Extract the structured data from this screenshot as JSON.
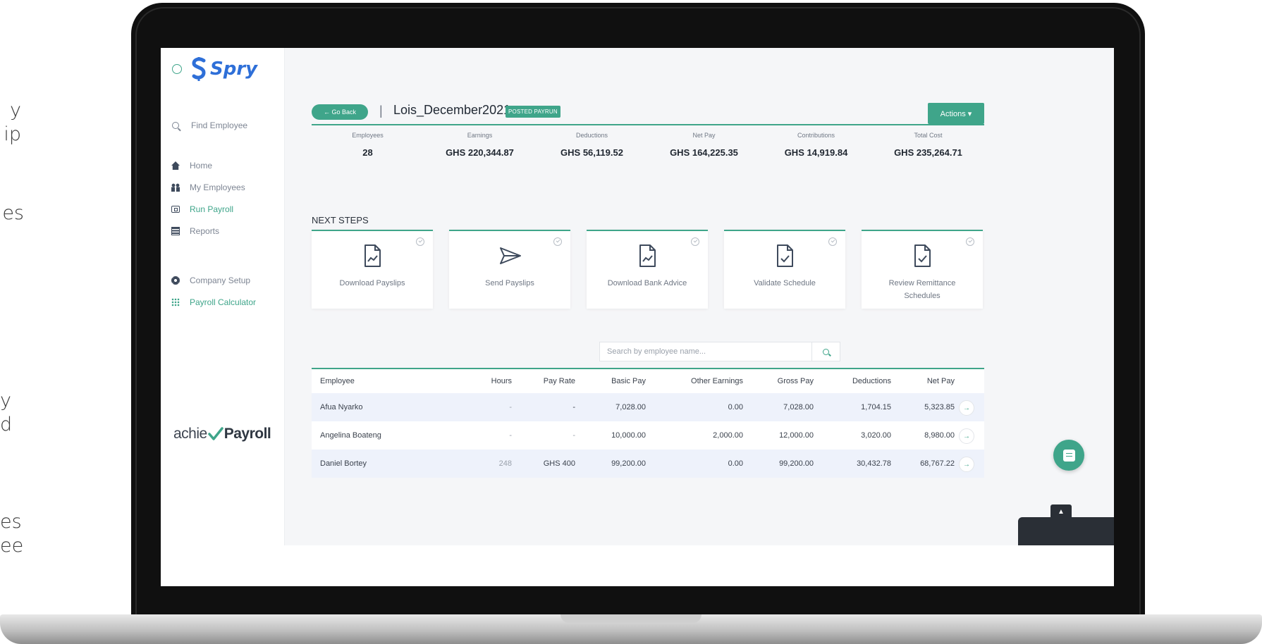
{
  "side_text": {
    "line1": "y",
    "line2": "ip",
    "line3": "es",
    "line4": "y",
    "line5": "d",
    "line6": "es",
    "line7": "ee"
  },
  "app": {
    "brand": "Spry",
    "find_employee": "Find Employee",
    "nav": [
      {
        "label": "Home",
        "icon": "home-icon"
      },
      {
        "label": "My Employees",
        "icon": "people-icon"
      },
      {
        "label": "Run Payroll",
        "icon": "money-icon"
      },
      {
        "label": "Reports",
        "icon": "report-icon"
      },
      {
        "label": "Company Setup",
        "icon": "gear-icon"
      },
      {
        "label": "Payroll Calculator",
        "icon": "grid-icon"
      }
    ],
    "footer_brand_a": "achie",
    "footer_brand_b": "Payroll"
  },
  "header": {
    "back_label": "← Go Back",
    "separator": "|",
    "title": "Lois_December2021",
    "status_badge": "POSTED PAYRUN",
    "actions_label": "Actions ▾"
  },
  "summary": [
    {
      "label": "Employees",
      "value": "28"
    },
    {
      "label": "Earnings",
      "value": "GHS 220,344.87"
    },
    {
      "label": "Deductions",
      "value": "GHS 56,119.52"
    },
    {
      "label": "Net Pay",
      "value": "GHS 164,225.35"
    },
    {
      "label": "Contributions",
      "value": "GHS 14,919.84"
    },
    {
      "label": "Total Cost",
      "value": "GHS 235,264.71"
    }
  ],
  "next_steps": {
    "title": "NEXT STEPS",
    "cards": [
      {
        "label": "Download Payslips",
        "icon": "document-chart-icon"
      },
      {
        "label": "Send Payslips",
        "icon": "send-icon"
      },
      {
        "label": "Download Bank Advice",
        "icon": "document-chart-icon"
      },
      {
        "label": "Validate Schedule",
        "icon": "document-check-icon"
      },
      {
        "label": "Review Remittance Schedules",
        "icon": "document-check-icon"
      }
    ]
  },
  "search": {
    "placeholder": "Search by employee name..."
  },
  "table": {
    "columns": [
      "Employee",
      "Hours",
      "Pay Rate",
      "Basic Pay",
      "Other Earnings",
      "Gross Pay",
      "Deductions",
      "Net Pay"
    ],
    "rows": [
      {
        "employee": "Afua Nyarko",
        "hours": "-",
        "rate": "-",
        "basic": "7,028.00",
        "other": "0.00",
        "gross": "7,028.00",
        "deductions": "1,704.15",
        "net": "5,323.85"
      },
      {
        "employee": "Angelina Boateng",
        "hours": "-",
        "rate": "-",
        "basic": "10,000.00",
        "other": "2,000.00",
        "gross": "12,000.00",
        "deductions": "3,020.00",
        "net": "8,980.00"
      },
      {
        "employee": "Daniel Bortey",
        "hours": "248",
        "rate": "GHS 400",
        "basic": "99,200.00",
        "other": "0.00",
        "gross": "99,200.00",
        "deductions": "30,432.78",
        "net": "68,767.22"
      }
    ],
    "row_action": "→"
  },
  "colors": {
    "accent": "#3fa58a",
    "brand_blue": "#2e6fd8"
  }
}
